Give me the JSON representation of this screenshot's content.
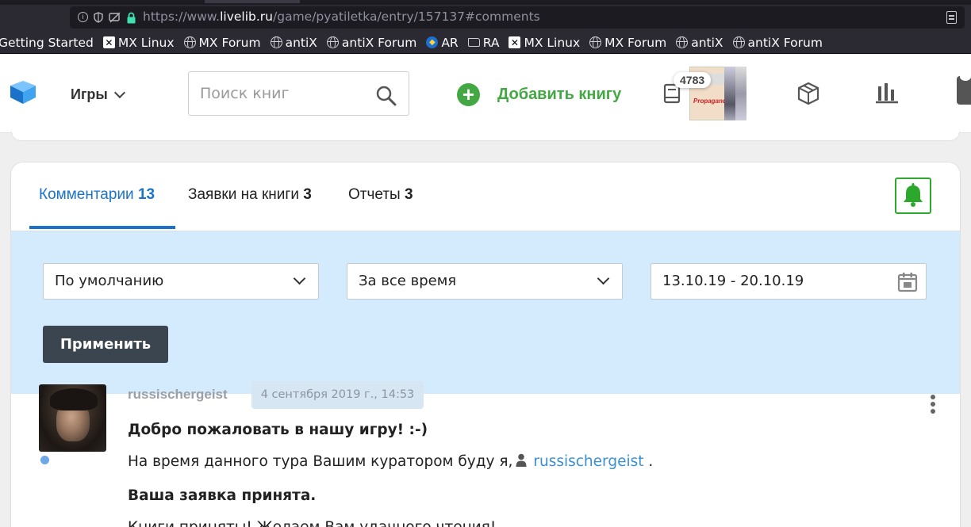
{
  "browser": {
    "url_prefix": "https://www.",
    "url_host": "livelib.ru",
    "url_path": "/game/pyatiletka/entry/157137#comments",
    "bookmarks": [
      {
        "label": "Getting Started",
        "icon": "none"
      },
      {
        "label": "MX Linux",
        "icon": "x-logo-icon"
      },
      {
        "label": "MX Forum",
        "icon": "globe-icon"
      },
      {
        "label": "antiX",
        "icon": "globe-icon"
      },
      {
        "label": "antiX Forum",
        "icon": "globe-icon"
      },
      {
        "label": "AR",
        "icon": "bird-icon"
      },
      {
        "label": "RA",
        "icon": "folder-icon"
      },
      {
        "label": "MX Linux",
        "icon": "x-logo-icon"
      },
      {
        "label": "MX Forum",
        "icon": "globe-icon"
      },
      {
        "label": "antiX",
        "icon": "globe-icon"
      },
      {
        "label": "antiX Forum",
        "icon": "globe-icon"
      }
    ]
  },
  "header": {
    "games_label": "Игры",
    "search_placeholder": "Поиск книг",
    "add_book_label": "Добавить книгу",
    "book_count": "4783",
    "cover_text": "Propaganda",
    "colors": {
      "brand_blue": "#1a73c9",
      "green": "#43a843"
    }
  },
  "tabs": {
    "comments_label": "Комментарии",
    "comments_count": "13",
    "requests_label": "Заявки на книги",
    "requests_count": "3",
    "reports_label": "Отчеты",
    "reports_count": "3"
  },
  "filters": {
    "sort_value": "По умолчанию",
    "period_value": "За все время",
    "date_range": "13.10.19 - 20.10.19",
    "apply_label": "Применить"
  },
  "comment": {
    "author": "russischergeist",
    "date": "4 сентября 2019 г., 14:53",
    "welcome": "Добро пожаловать в нашу игру! :-)",
    "curator_text": "На время данного тура Вашим куратором буду я,",
    "curator_name": "russischergeist",
    "curator_end": ".",
    "accepted": "Ваша заявка принята.",
    "next_line": "Книги приняты! Желаем Вам удачного чтения!"
  }
}
